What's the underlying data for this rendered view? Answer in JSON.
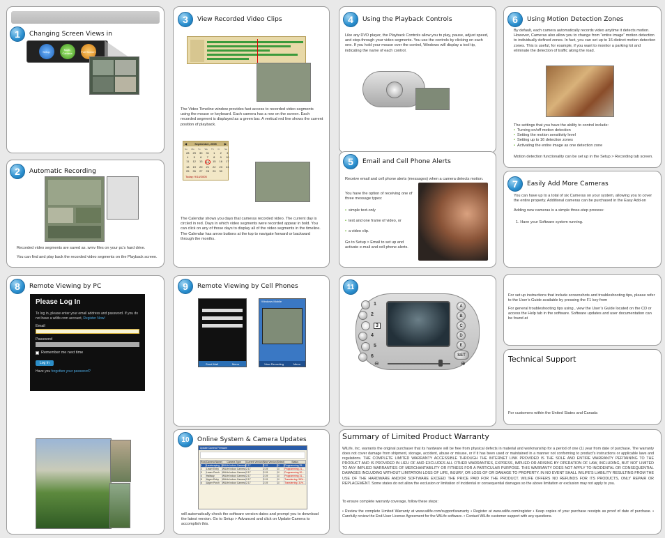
{
  "panels": {
    "p1": {
      "number": "1",
      "title": "Changing Screen Views in",
      "round_buttons": [
        "Setup",
        "Multi-Camera",
        "Full Screen"
      ]
    },
    "p2": {
      "number": "2",
      "title": "Automatic Recording",
      "text1": "Recorded video segments are saved as .wmv files on your pc’s hard drive.",
      "text2": "You can find and play back the recorded video segments on the Playback screen."
    },
    "p3": {
      "number": "3",
      "title": "View Recorded Video Clips",
      "text1": "The Video Timeline window provides fast access to recorded video segments using the mouse or keyboard. Each camera has a row on the screen. Each recorded segment is displayed as a green bar. A vertical red line shows the current position of playback.",
      "text2": "The Calendar shows you days that cameras recorded video. The current day is circled in red. Days in which video segments were recorded appear in bold. You can click on any of those days to display all of the video segments in the timeline. The Calendar has arrow buttons at the top to navigate forward or backward through the months.",
      "calendar_month": "September, 2005",
      "calendar_days": [
        "Sun",
        "Mon",
        "Tue",
        "Wed",
        "Thu",
        "Fri",
        "Sat"
      ],
      "calendar_rows": [
        [
          "28",
          "29",
          "30",
          "31",
          "1",
          "2",
          "3"
        ],
        [
          "4",
          "5",
          "6",
          "7",
          "8",
          "9",
          "10"
        ],
        [
          "11",
          "12",
          "13",
          "14",
          "15",
          "16",
          "17"
        ],
        [
          "18",
          "19",
          "20",
          "21",
          "22",
          "23",
          "24"
        ],
        [
          "25",
          "26",
          "27",
          "28",
          "29",
          "30",
          ""
        ]
      ],
      "today_label": "Today: 9/14/2005"
    },
    "p4": {
      "number": "4",
      "title": "Using the Playback Controls",
      "text": "Like any DVD player, the Playback Controls allow you to play, pause, adjust speed, and step-through your video segments. You use the controls by clicking on each one. If you hold your mouse over the control, Windows will display a tool tip, indicating the name of each control."
    },
    "p5": {
      "number": "5",
      "title": "Email and Cell Phone Alerts",
      "intro": "Receive email and cell phone alerts (messages) when a camera detects motion.",
      "types_intro": "You have the option of receiving one of three message types:",
      "types": [
        "simple text-only",
        "text and one frame of video, or",
        "a video clip."
      ],
      "outro": "Go to Setup > Email to set up and activate e-mail and cell phone alerts."
    },
    "p6": {
      "number": "6",
      "title": "Using Motion Detection Zones",
      "text": "By default, each camera automatically records video anytime it detects motion. However, Cameras also allow you to change from “entire image” motion detection to individually defined zones. In fact, you can set up to 16 distinct motion detection zones. This is useful, for example, if you want to monitor a parking lot and eliminate the detection of traffic along the road.",
      "list_intro": "The settings that you have the ability to control include:",
      "list": [
        "Turning on/off motion detection",
        "Setting the motion sensitivity level",
        "Setting up to 16 detection zones",
        "Activating the entire image as one detection zone"
      ],
      "outro": "Motion detection functionality can be set up in the Setup > Recording tab screen."
    },
    "p7": {
      "number": "7",
      "title": "Easily Add More Cameras",
      "text": "You can have up to a total of six Cameras on your system, allowing you to cover the entire property. Additional cameras can be purchased in the Easy Add-on",
      "text2": "Adding new cameras is a simple three-step process:",
      "step1": "1. Have your Software system running."
    },
    "p8": {
      "number": "8",
      "title": "Remote Viewing by PC",
      "login_title": "Please Log In",
      "login_sub": "To log in, please enter your email address and password. If you do not have a wilife.com account,",
      "register_link": "Register Now!",
      "email_label": "Email",
      "password_label": "Password",
      "remember_label": "Remember me next time",
      "login_button": "Log In",
      "forgot_prefix": "Have you",
      "forgot_link": "forgotten your password?"
    },
    "p9": {
      "number": "9",
      "title": "Remote Viewing by Cell Phones",
      "phone1_menu": [
        "Send Mail",
        "Menu"
      ],
      "phone2_title": "Windows Mobile",
      "phone2_menu": [
        "View Recording",
        "Menu"
      ]
    },
    "p10": {
      "number": "10",
      "title": "Online System & Camera Updates",
      "dialog_title": "Update Camera Firmware",
      "table_headers": [
        "Row",
        "Camera Name",
        "Camera Type",
        "Current Version",
        "New Version",
        "Select",
        "Status"
      ],
      "table_rows": [
        [
          "1",
          "Landscaping",
          "WiLife Indoor Camera",
          "2.17",
          "2.19",
          "Programming 25..."
        ],
        [
          "2",
          "Lower Entry",
          "WiLife Indoor Camera",
          "2.17",
          "2.19",
          "Programming 21..."
        ],
        [
          "3",
          "Lower Porch",
          "WiLife Indoor Camera",
          "2.17",
          "2.19",
          "Programming 20..."
        ],
        [
          "4",
          "Hallway",
          "WiLife Indoor Camera",
          "2.17",
          "2.19",
          "Programming 31..."
        ],
        [
          "5",
          "Upper Entry",
          "WiLife Indoor Camera",
          "2.17",
          "2.19",
          "Transferring: 95%..."
        ],
        [
          "6",
          "Upper Porch",
          "WiLife Indoor Camera",
          "2.17",
          "2.19",
          "Transferring: 31%..."
        ]
      ],
      "text": "will automatically check the software version dates and prompt you to download the latest version. Go to Setup > Advanced and click on Update Camera to accomplish this."
    },
    "p11": {
      "number": "11",
      "left_numbers": [
        "1",
        "2",
        "3",
        "4",
        "5",
        "6"
      ],
      "right_buttons": [
        "A",
        "B",
        "C",
        "D",
        "E",
        "SET"
      ]
    },
    "support": {
      "text1": "For set up instructions that include screenshots and troubleshooting tips, please refer to the User’s Guide available by pressing the F1 key from",
      "text2": "For general troubleshooting tips using , view the User’s Guide located on the CD or access the Help tab in the software. Software updates and user documentation can be found at",
      "heading": "Technical Support",
      "customers": "For customers within the United States and Canada"
    },
    "warranty": {
      "heading": "Summary of Limited Product Warranty",
      "body": "WiLife, Inc. warrants the original purchaser that its hardware will be free from physical defects in material and workmanship for a period of one (1) year from date of purchase. The warranty does not cover damage from shipment, storage, accident, abuse or misuse, or if it has been used or maintained in a manner not conforming to product’s instructions or applicable laws and regulations. THE COMPLETE LIMITED WARRANTY ACCESSIBLE THROUGH THE INTERNET LINK PROVIDED IS THE SOLE AND ENTIRE WARRANTY PERTAINING TO THE PRODUCT AND IS PROVIDED IN LIEU OF AND EXCLUDES ALL OTHER WARRANTIES, EXPRESS, IMPLIED OR ARISING BY OPERATION OF LAW, INCLUDING, BUT NOT LIMITED TO ANY IMPLIED WARRANTIES OF MERCHANTABILITY OR FITNESS FOR A PARTICULAR PURPOSE. THIS WARRANTY DOES NOT APPLY TO INCIDENTAL OR CONSEQUENTIAL DAMAGES INCLUDING WITHOUT LIMITATION LOSS OF LIFE, INJURY, OR LOSS OF OR DAMAGE TO PROPERTY. IN NO EVENT SHALL WILIFE’S LIABILITY RESULTING FROM THE USE OF THE HARDWARE AND/OR SOFTWARE EXCEED THE PRICE PAID FOR THE PRODUCT. WILIFE OFFERS NO REFUNDS FOR ITS PRODUCTS, ONLY REPAIR OR REPLACEMENT. Some states do not allow the exclusion or limitation of incidental or consequential damages so the above limitation or exclusion may not apply to you.",
      "steps_intro": "To ensure complete warranty coverage, follow these steps:",
      "steps": "• Review the complete Limited Warranty at www.wilife.com/support/warranty • Register at www.wilife.com/register • Keep copies of your purchase receipts as proof of date of purchase. • Carefully review the End-User License Agreement for the WiLife software. • Contact WiLife customer support with any questions."
    }
  },
  "colors": {
    "badge": "#2a8fcf",
    "accent_green": "#6ab82f",
    "timeline_bg": "#e8d9a8",
    "login_bg": "#0f0f0f"
  }
}
